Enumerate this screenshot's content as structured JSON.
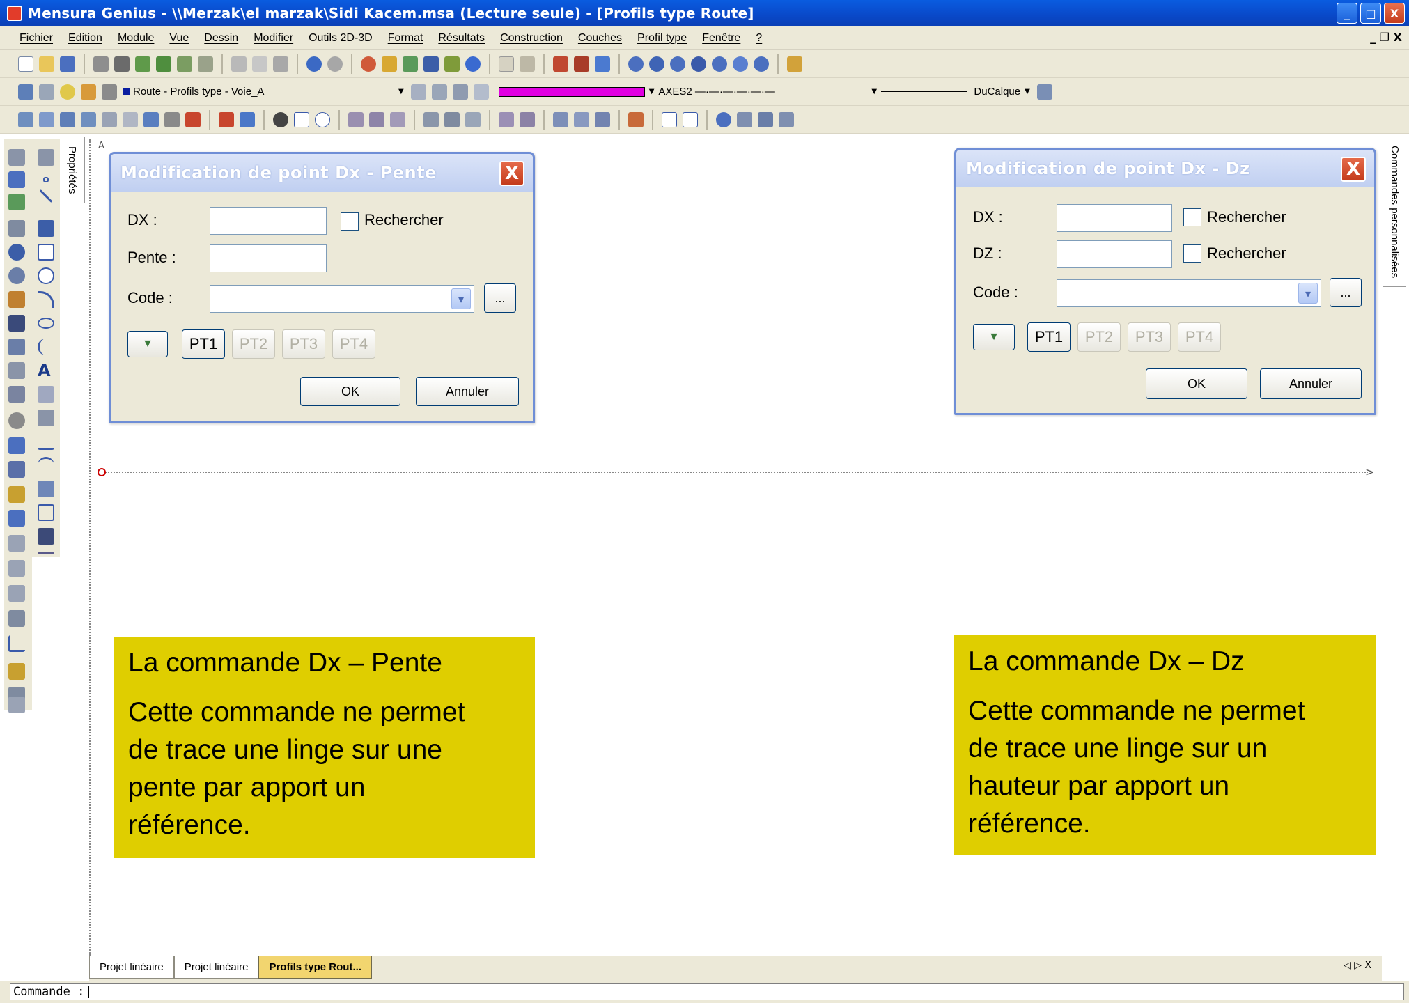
{
  "window": {
    "title": "Mensura Genius - \\\\Merzak\\el marzak\\Sidi Kacem.msa (Lecture seule) - [Profils type Route]",
    "buttons": [
      "_",
      "□",
      "X"
    ]
  },
  "menu": {
    "items": [
      "Fichier",
      "Edition",
      "Module",
      "Vue",
      "Dessin",
      "Modifier",
      "Outils 2D-3D",
      "Format",
      "Résultats",
      "Construction",
      "Couches",
      "Profil type",
      "Fenêtre",
      "?"
    ],
    "mdi_controls": "_ ❐ X"
  },
  "layer_toolbar": {
    "layer_name": "Route - Profils type - Voie_A",
    "color": "#e100e1",
    "linetype": "AXES2 —·—·—·—·—·—",
    "lineweight": "DuCalque"
  },
  "side_tabs": {
    "left": "Propriétés",
    "right": "Commandes personnalisées"
  },
  "canvas": {
    "axis_label": "A",
    "axis_arrow": ">"
  },
  "dialog_left": {
    "title": "Modification de point Dx - Pente",
    "close": "X",
    "label_dx": "DX :",
    "label_pente": "Pente :",
    "label_code": "Code :",
    "checkbox_label": "Rechercher",
    "dx_value": "",
    "pente_value": "",
    "code_value": "",
    "browse": "...",
    "points": [
      "PT1",
      "PT2",
      "PT3",
      "PT4"
    ],
    "ok": "OK",
    "cancel": "Annuler"
  },
  "dialog_right": {
    "title": "Modification de point Dx - Dz",
    "close": "X",
    "label_dx": "DX :",
    "label_dz": "DZ :",
    "label_code": "Code :",
    "checkbox_label_dx": "Rechercher",
    "checkbox_label_dz": "Rechercher",
    "dx_value": "",
    "dz_value": "",
    "code_value": "",
    "browse": "...",
    "points": [
      "PT1",
      "PT2",
      "PT3",
      "PT4"
    ],
    "ok": "OK",
    "cancel": "Annuler"
  },
  "note_left": {
    "heading": "La commande Dx – Pente",
    "lines": [
      "Cette commande ne permet",
      "de trace une linge sur une",
      "pente par apport un",
      "référence."
    ]
  },
  "note_right": {
    "heading": "La commande Dx – Dz",
    "lines": [
      "Cette commande ne permet",
      "de trace une linge sur un",
      "hauteur par apport un",
      "référence."
    ]
  },
  "bottom_tabs": {
    "items": [
      "Projet linéaire",
      "Projet linéaire",
      "Profils type Rout..."
    ],
    "controls": "◁ ▷ X"
  },
  "command_line": {
    "label": "Commande :"
  },
  "colors": {
    "note_bg": "#dfce00",
    "dialog_border": "#6f8ed6",
    "titlebar": "#0948c8"
  }
}
